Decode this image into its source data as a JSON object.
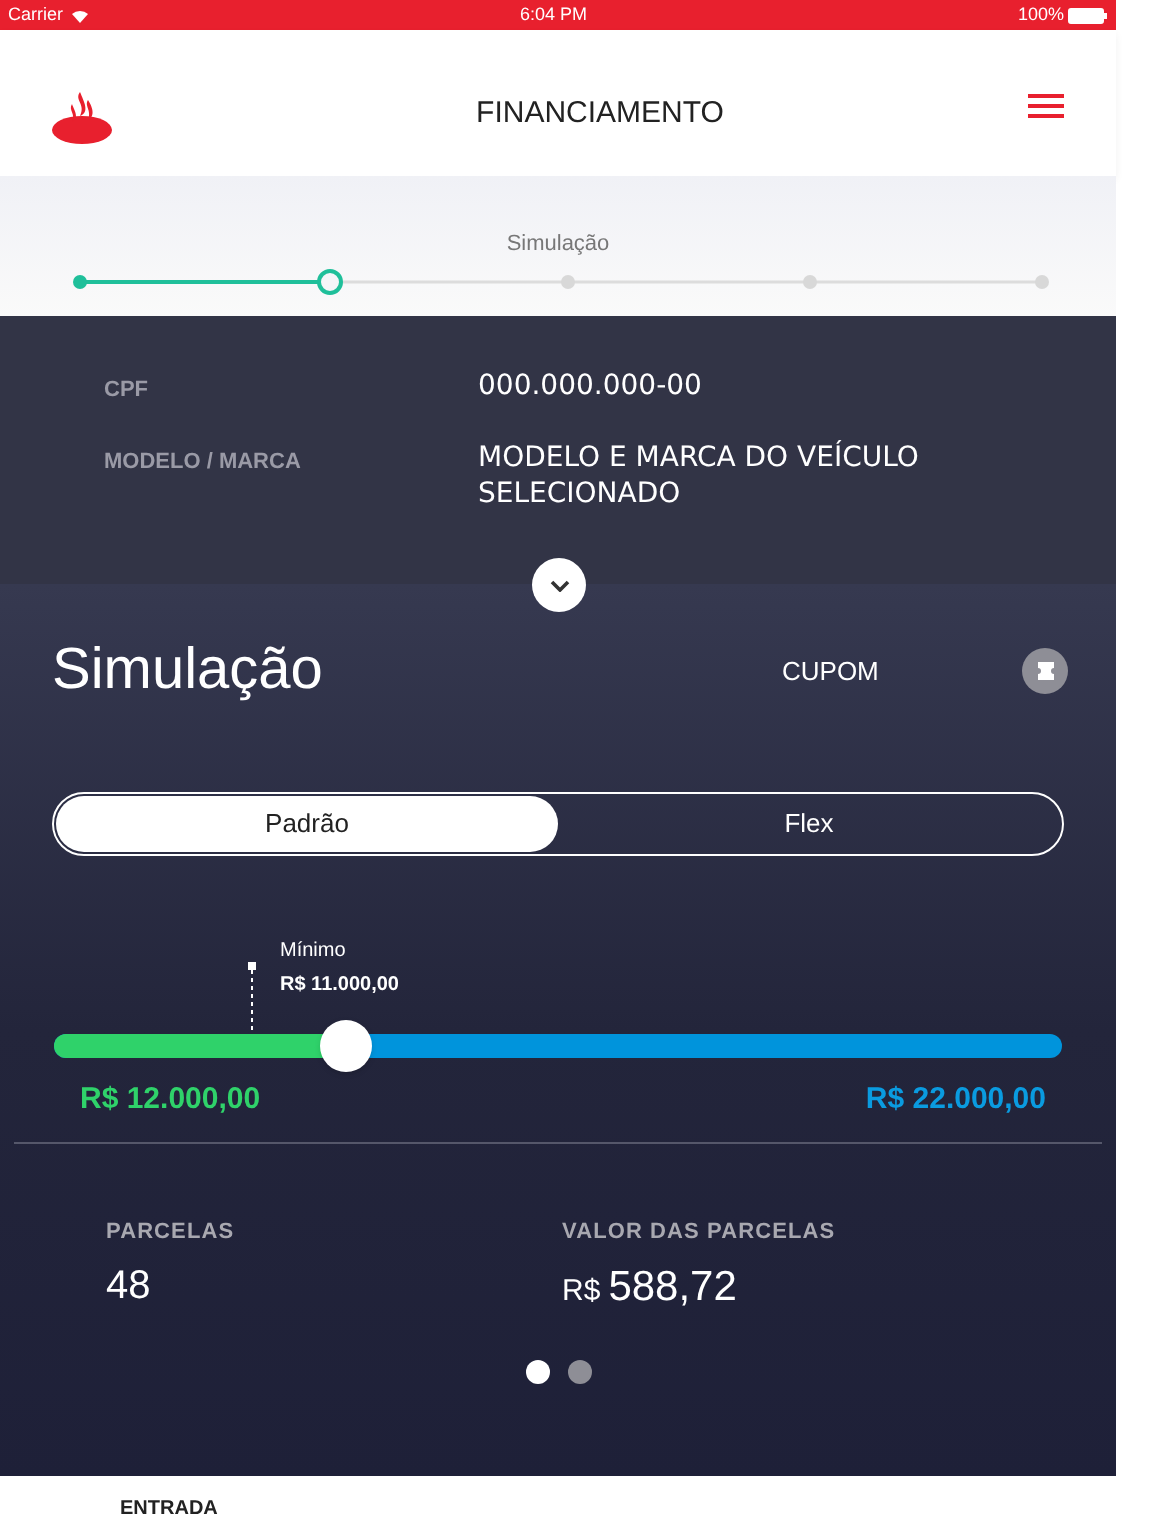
{
  "status_bar": {
    "carrier": "Carrier",
    "time": "6:04 PM",
    "battery": "100%"
  },
  "header": {
    "title": "FINANCIAMENTO"
  },
  "stepper": {
    "label": "Simulação",
    "steps": [
      {
        "kind": "done"
      },
      {
        "kind": "current"
      },
      {
        "kind": "pending"
      },
      {
        "kind": "pending"
      },
      {
        "kind": "pending"
      }
    ]
  },
  "details": [
    {
      "label": "CPF",
      "value": "000.000.000-00"
    },
    {
      "label": "MODELO / MARCA",
      "value": "MODELO E MARCA DO VEÍCULO SELECIONADO"
    }
  ],
  "simulation": {
    "title": "Simulação",
    "coupon": "CUPOM",
    "tabs": [
      {
        "label": "Padrão",
        "selected": true
      },
      {
        "label": "Flex",
        "selected": false
      }
    ],
    "slider": {
      "minimum_label": "Mínimo",
      "minimum_value": "R$ 11.000,00",
      "level": 0.29,
      "value": "R$ 12.000,00",
      "max": "R$ 22.000,00"
    },
    "installments": {
      "label": "PARCELAS",
      "value": "48"
    },
    "installment_value": {
      "label": "VALOR DAS PARCELAS",
      "currency": "R$",
      "value": "588,72"
    },
    "pages": [
      {
        "selected": true
      },
      {
        "selected": false
      }
    ]
  },
  "next_section": {
    "label": "ENTRADA"
  }
}
